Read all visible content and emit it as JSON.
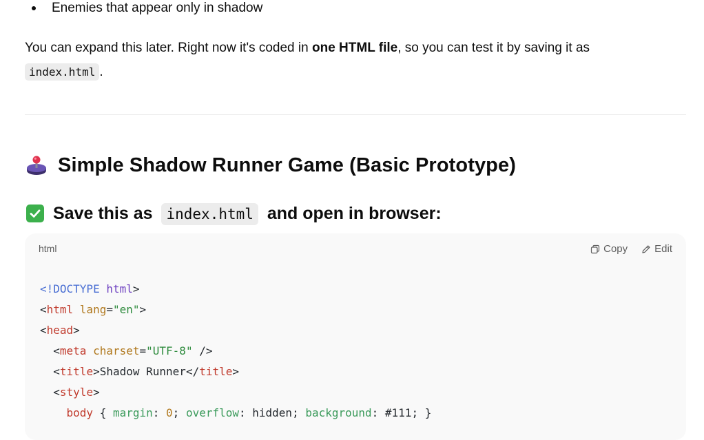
{
  "bullet": {
    "text": "Enemies that appear only in shadow"
  },
  "paragraph": {
    "part1": "You can expand this later. Right now it's coded in ",
    "bold": "one HTML file",
    "part2": ", so you can test it by saving it as ",
    "code": "index.html",
    "part3": "."
  },
  "heading": {
    "icon": "joystick-icon",
    "title": "Simple Shadow Runner Game (Basic Prototype)"
  },
  "subheading": {
    "icon": "check-mark-icon",
    "before": "Save this as ",
    "code": "index.html",
    "after": " and open in browser:"
  },
  "code_block": {
    "language": "html",
    "copy_label": "Copy",
    "edit_label": "Edit",
    "lines": {
      "l1_a": "<!DOCTYPE",
      "l1_b": " html",
      "l1_c": ">",
      "l2_a": "<",
      "l2_tag": "html",
      "l2_attr": " lang",
      "l2_eq": "=",
      "l2_val": "\"en\"",
      "l2_end": ">",
      "l3_a": "<",
      "l3_tag": "head",
      "l3_end": ">",
      "l4_indent": "  ",
      "l4_a": "<",
      "l4_tag": "meta",
      "l4_attr": " charset",
      "l4_eq": "=",
      "l4_val": "\"UTF-8\"",
      "l4_end": " />",
      "l5_indent": "  ",
      "l5_a": "<",
      "l5_tag": "title",
      "l5_mid": ">Shadow Runner</",
      "l5_tag2": "title",
      "l5_end": ">",
      "l6_indent": "  ",
      "l6_a": "<",
      "l6_tag": "style",
      "l6_end": ">",
      "l7_indent": "    ",
      "l7_sel": "body",
      "l7_open": " { ",
      "l7_p1": "margin",
      "l7_c1": ": ",
      "l7_v1": "0",
      "l7_s1": "; ",
      "l7_p2": "overflow",
      "l7_c2": ": hidden; ",
      "l7_p3": "background",
      "l7_c3": ": #111; }"
    }
  },
  "colors": {
    "check_green": "#3cb04c",
    "code_bg": "#f9f9f9",
    "inline_code_bg": "#ececec"
  }
}
